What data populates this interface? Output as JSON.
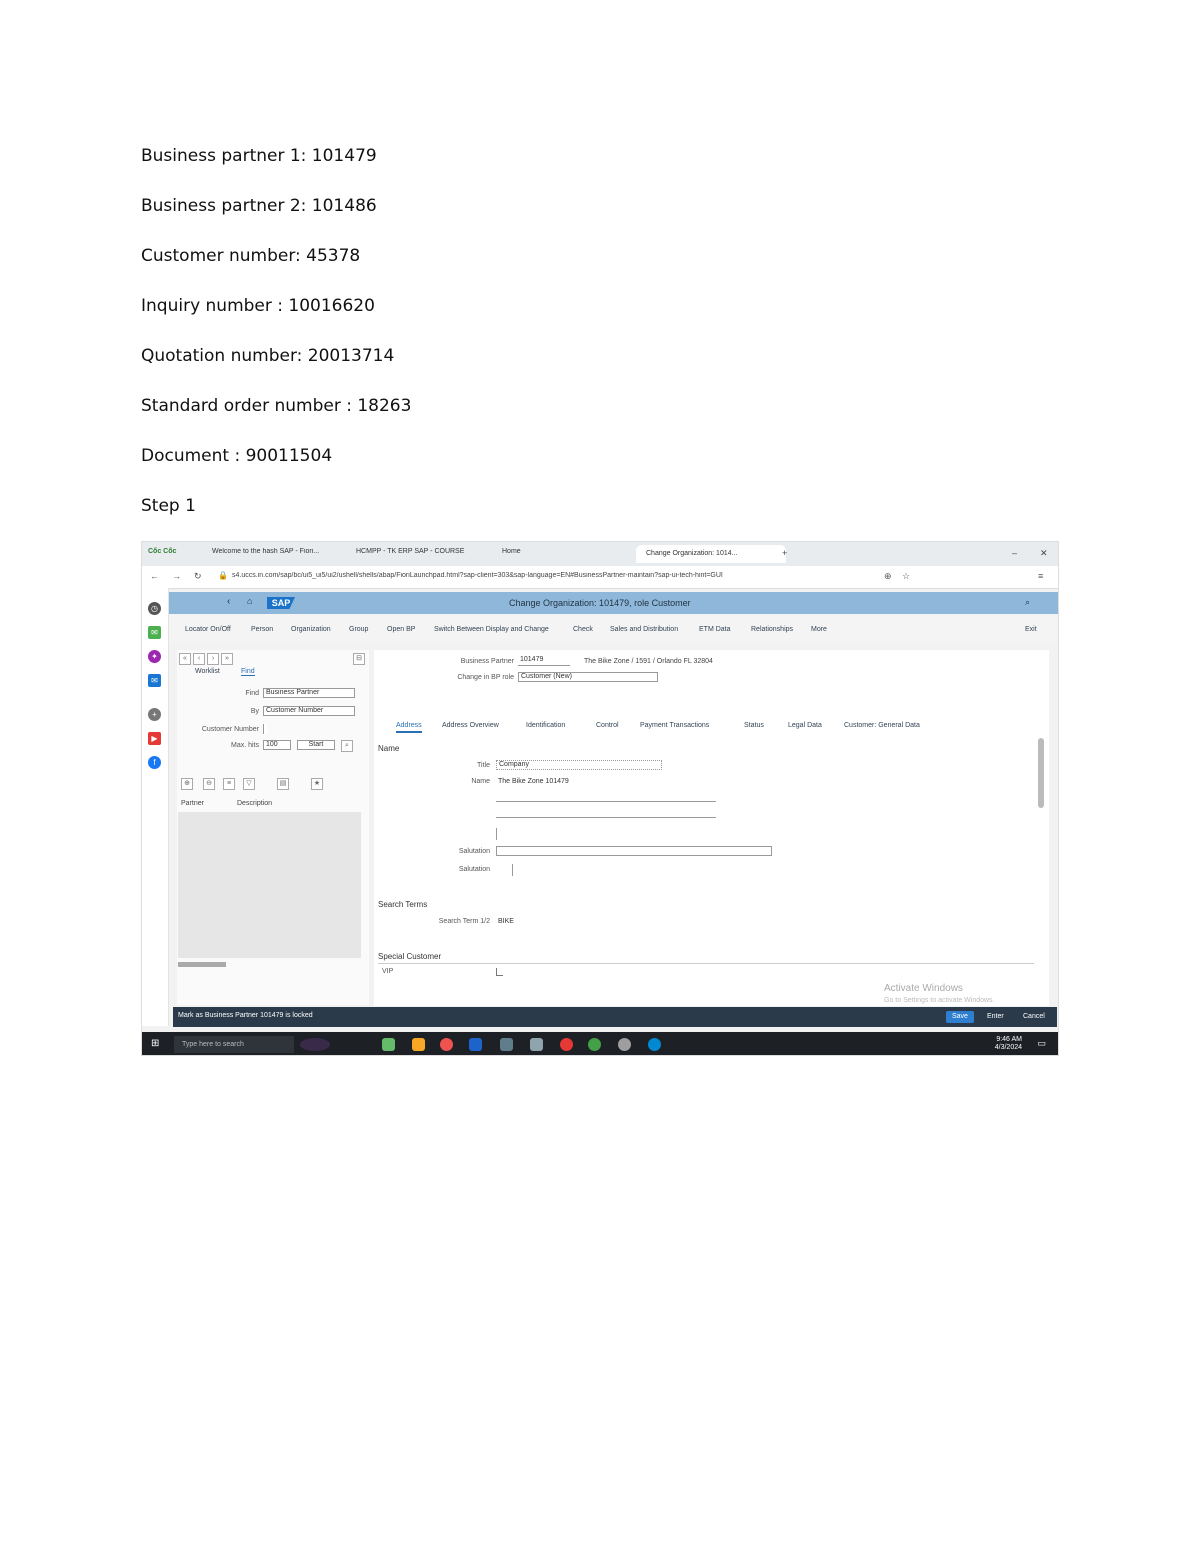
{
  "doc": {
    "lines": [
      "Business partner 1: 101479",
      "Business partner 2: 101486",
      "Customer number: 45378",
      "Inquiry number : 10016620",
      "Quotation number: 20013714",
      "Standard order number : 18263",
      "Document : 90011504",
      "Step 1"
    ]
  },
  "screenshot": {
    "browser": {
      "brand": "Cốc Cốc",
      "tabs": [
        "Welcome to the hash SAP - Fiori...",
        "HCMPP - TK ERP SAP - COURSE",
        "Home"
      ],
      "active_tab": "Change Organization: 1014...",
      "url": "s4.uccs.in.com/sap/bc/ui5_ui5/ui2/ushell/shells/abap/FioriLaunchpad.html?sap-client=303&sap-language=EN#BusinessPartner-maintain?sap-ui-tech-hint=GUI"
    },
    "sap": {
      "logo": "SAP",
      "title": "Change Organization: 101479, role Customer",
      "menu": [
        "Locator On/Off",
        "Person",
        "Organization",
        "Group",
        "Open BP",
        "Switch Between Display and Change",
        "Check",
        "Sales and Distribution",
        "ETM Data",
        "Relationships",
        "More"
      ],
      "exit": "Exit",
      "worklist_tab": "Worklist",
      "find_tab": "Find",
      "find_label": "Find",
      "find_value": "Business Partner",
      "by_label": "By",
      "by_value": "Customer Number",
      "customer_label": "Customer Number",
      "maxhits_label": "Max. hits",
      "maxhits_value": "100",
      "start_label": "Start",
      "col_partner": "Partner",
      "col_desc": "Description",
      "bp_label": "Business Partner",
      "bp_value": "101479",
      "bp_desc": "The Bike Zone / 1591 / Orlando FL 32804",
      "role_label": "Change in BP role",
      "role_value": "Customer (New)",
      "content_tabs": [
        "Address",
        "Address Overview",
        "Identification",
        "Control",
        "Payment Transactions",
        "Status",
        "Legal Data",
        "Customer: General Data"
      ],
      "name_section": "Name",
      "title_label": "Title",
      "title_value": "Company",
      "name_label": "Name",
      "name_value": "The Bike Zone 101479",
      "salutation_label": "Salutation",
      "salutation2_label": "Salutation",
      "search_section": "Search Terms",
      "search_label": "Search Term 1/2",
      "search_value": "BIKE",
      "special_section": "Special Customer",
      "vip_label": "VIP",
      "activate": "Activate Windows",
      "activate_sub": "Go to Settings to activate Windows.",
      "status_msg": "Mark as Business Partner 101479 is locked",
      "save": "Save",
      "enter": "Enter",
      "cancel": "Cancel"
    },
    "taskbar": {
      "search": "Type here to search",
      "time": "9:46 AM",
      "date": "4/3/2024"
    }
  }
}
